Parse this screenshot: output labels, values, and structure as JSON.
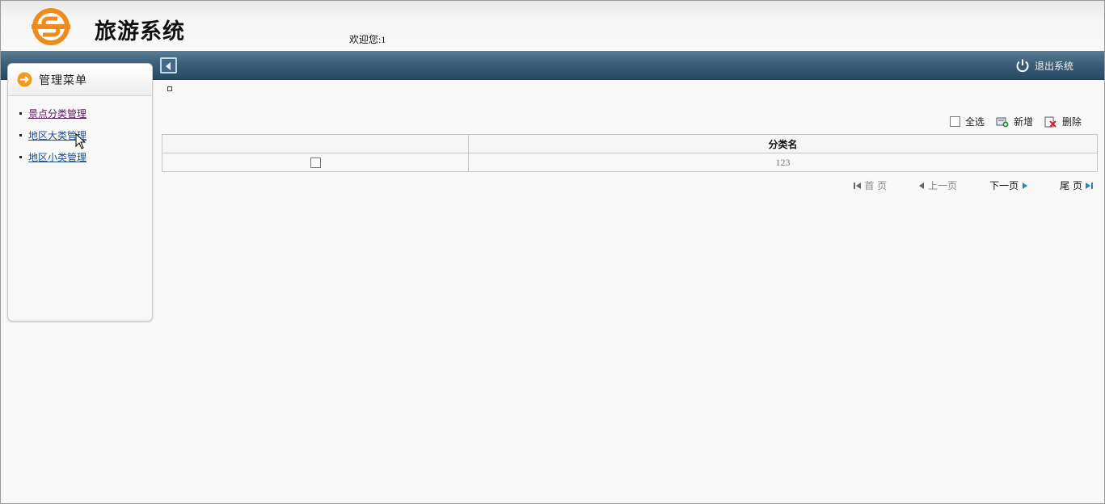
{
  "header": {
    "title": "旅游系统",
    "welcome": "欢迎您:1"
  },
  "topbar": {
    "logout_label": "退出系统"
  },
  "sidebar": {
    "title": "管理菜单",
    "items": [
      {
        "label": "景点分类管理"
      },
      {
        "label": "地区大类管理"
      },
      {
        "label": "地区小类管理"
      }
    ]
  },
  "toolbar": {
    "select_all": "全选",
    "add": "新增",
    "delete": "删除"
  },
  "table": {
    "columns": [
      "",
      "分类名"
    ],
    "rows": [
      {
        "name": "123"
      }
    ]
  },
  "pager": {
    "first": "首 页",
    "prev": "上一页",
    "next": "下一页",
    "last": "尾 页"
  },
  "colors": {
    "topbar": "#3b5f7a",
    "logo_orange": "#f08a1c",
    "link": "#1f4f8f"
  }
}
